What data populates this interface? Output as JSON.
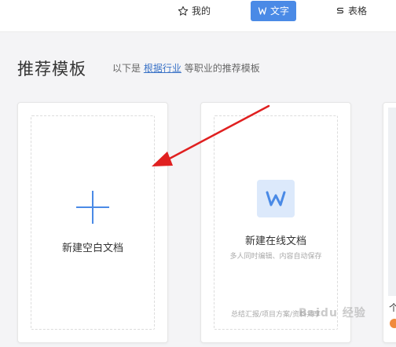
{
  "topbar": {
    "tabs": [
      {
        "label": "我的",
        "icon": "star-outline-icon"
      },
      {
        "label": "文字",
        "icon": "w-doc-icon",
        "active": true
      },
      {
        "label": "表格",
        "icon": "s-sheet-icon"
      }
    ]
  },
  "section": {
    "title": "推荐模板",
    "subtitle_prefix": "以下是",
    "subtitle_link": "根据行业",
    "subtitle_suffix": "等职业的推荐模板"
  },
  "cards": {
    "blank": {
      "label": "新建空白文档",
      "icon": "plus-icon"
    },
    "online": {
      "title": "新建在线文档",
      "subtitle": "多人同时编辑、内容自动保存",
      "tags": "总结汇报/项目方案/资料共享",
      "icon": "w-doc-icon"
    },
    "partial": {
      "label": "个"
    }
  },
  "watermark": "Baidu 经验",
  "colors": {
    "accent": "#4a8ae6",
    "annotation_arrow": "#e02020"
  }
}
